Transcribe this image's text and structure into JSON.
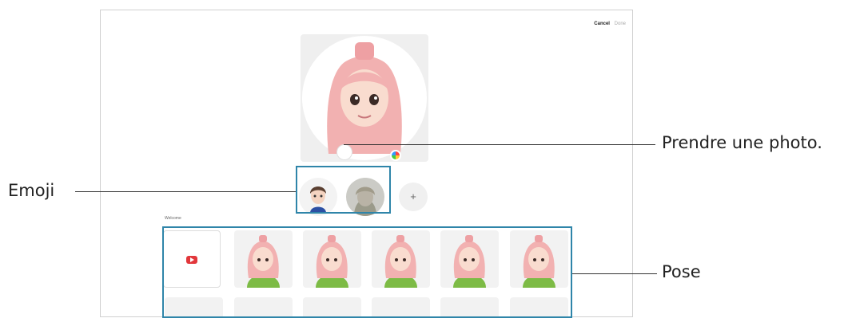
{
  "toolbar": {
    "cancel_label": "Cancel",
    "done_label": "Done"
  },
  "pose_section_label": "Welcome",
  "add_emoji_label": "+",
  "callouts": {
    "photo": "Prendre une photo.",
    "emoji": "Emoji",
    "pose": "Pose"
  },
  "colors": {
    "highlight_box": "#2f85a9",
    "record_icon": "#e2373b",
    "avatar_hair": "#f2b1b1",
    "avatar_top": "#7dbb45"
  },
  "icons": {
    "color_palette": "color-palette-icon",
    "shutter": "shutter-button-icon",
    "add": "plus-icon",
    "video": "play-icon"
  }
}
